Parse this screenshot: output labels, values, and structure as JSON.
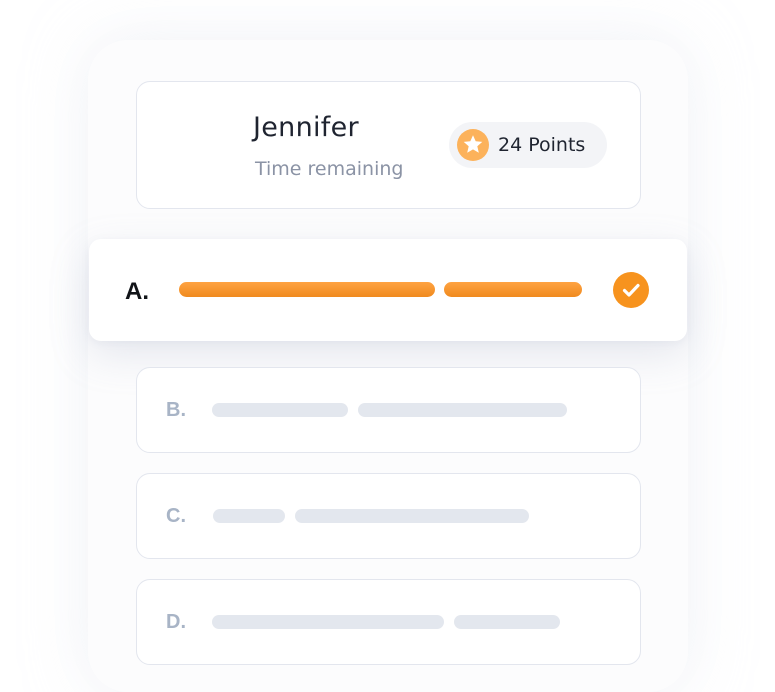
{
  "header": {
    "player_name": "Jennifer",
    "time_label": "Time remaining",
    "points_label": "24 Points"
  },
  "options": [
    {
      "letter": "A.",
      "selected": true
    },
    {
      "letter": "B.",
      "selected": false
    },
    {
      "letter": "C.",
      "selected": false
    },
    {
      "letter": "D.",
      "selected": false
    }
  ],
  "icons": {
    "points": "star-icon",
    "selected": "check-circle-icon"
  },
  "colors": {
    "accent": "#f7931e",
    "star_badge": "#fcb25b",
    "placeholder_bar": "#e3e7ee",
    "muted_letter": "#a8b4c6",
    "border": "#e3e6ee"
  }
}
